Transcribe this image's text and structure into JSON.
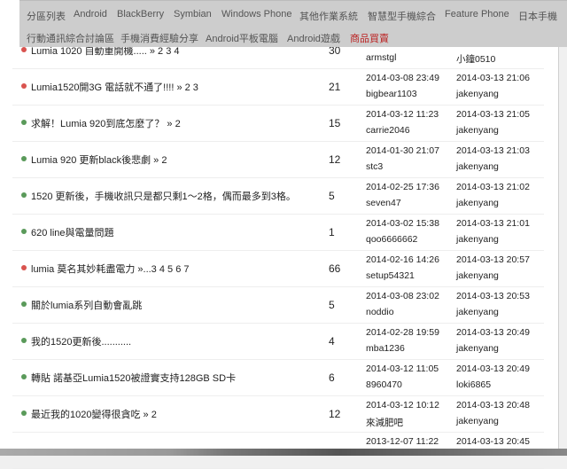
{
  "nav": {
    "items": [
      {
        "label": "分區列表"
      },
      {
        "label": "Android"
      },
      {
        "label": "BlackBerry"
      },
      {
        "label": "Symbian"
      },
      {
        "label": "Windows Phone"
      },
      {
        "label": "其他作業系統"
      },
      {
        "label": "智慧型手機綜合"
      },
      {
        "label": "Feature Phone"
      },
      {
        "label": "日本手機"
      },
      {
        "label": "行動通訊綜合討論區"
      },
      {
        "label": "手機消費經驗分享"
      },
      {
        "label": "Android平板電腦"
      },
      {
        "label": "Android遊戲"
      },
      {
        "label": "商品買賣"
      }
    ]
  },
  "colors": {
    "hot": "#d9534f",
    "normal": "#5a9a5a"
  },
  "threads": [
    {
      "title": "Lumia 1020 自動重開機..... » 2 3 4",
      "hot": true,
      "replies": "30",
      "created": "",
      "author": "armstgl",
      "last_time": "",
      "last_user": "小鐘0510"
    },
    {
      "title": "Lumia1520開3G 電話就不通了!!!! » 2 3",
      "hot": true,
      "replies": "21",
      "created": "2014-03-08 23:49",
      "author": "bigbear1103",
      "last_time": "2014-03-13 21:06",
      "last_user": "jakenyang"
    },
    {
      "title": "求解！Lumia 920到底怎麼了？ » 2",
      "hot": false,
      "replies": "15",
      "created": "2014-03-12 11:23",
      "author": "carrie2046",
      "last_time": "2014-03-13 21:05",
      "last_user": "jakenyang"
    },
    {
      "title": "Lumia 920 更新black後悲劇 » 2",
      "hot": false,
      "replies": "12",
      "created": "2014-01-30 21:07",
      "author": "stc3",
      "last_time": "2014-03-13 21:03",
      "last_user": "jakenyang"
    },
    {
      "title": "1520 更新後，手機收訊只是都只剩1～2格，偶而最多到3格。",
      "hot": false,
      "replies": "5",
      "created": "2014-02-25 17:36",
      "author": "seven47",
      "last_time": "2014-03-13 21:02",
      "last_user": "jakenyang"
    },
    {
      "title": "620 line與電量問題",
      "hot": false,
      "replies": "1",
      "created": "2014-03-02 15:38",
      "author": "qoo6666662",
      "last_time": "2014-03-13 21:01",
      "last_user": "jakenyang"
    },
    {
      "title": "lumia 莫名其妙耗盡電力 »...3 4 5 6 7",
      "hot": true,
      "replies": "66",
      "created": "2014-02-16 14:26",
      "author": "setup54321",
      "last_time": "2014-03-13 20:57",
      "last_user": "jakenyang"
    },
    {
      "title": "關於lumia系列自動會亂跳",
      "hot": false,
      "replies": "5",
      "created": "2014-03-08 23:02",
      "author": "noddio",
      "last_time": "2014-03-13 20:53",
      "last_user": "jakenyang"
    },
    {
      "title": "我的1520更新後...........",
      "hot": false,
      "replies": "4",
      "created": "2014-02-28 19:59",
      "author": "mba1236",
      "last_time": "2014-03-13 20:49",
      "last_user": "jakenyang"
    },
    {
      "title": "轉貼 諾基亞Lumia1520被證實支持128GB SD卡",
      "hot": false,
      "replies": "6",
      "created": "2014-03-12 11:05",
      "author": "8960470",
      "last_time": "2014-03-13 20:49",
      "last_user": "loki6865"
    },
    {
      "title": "最近我的1020變得很貪吃 » 2",
      "hot": false,
      "replies": "12",
      "created": "2014-03-12 10:12",
      "author": "來減肥吧",
      "last_time": "2014-03-13 20:48",
      "last_user": "jakenyang"
    },
    {
      "title": "",
      "hot": false,
      "replies": "",
      "created": "2013-12-07 11:22",
      "author": "",
      "last_time": "2014-03-13 20:45",
      "last_user": ""
    }
  ]
}
